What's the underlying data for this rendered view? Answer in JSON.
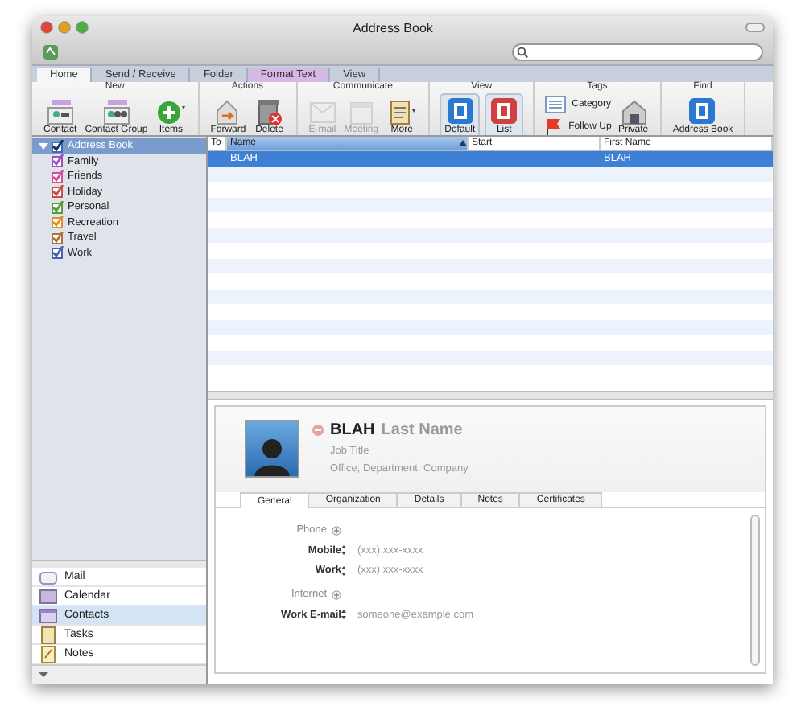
{
  "window": {
    "title": "Address Book"
  },
  "ribbon": {
    "tabs": [
      {
        "label": "Home",
        "selected": true,
        "contextual": false
      },
      {
        "label": "Send / Receive",
        "selected": false,
        "contextual": false
      },
      {
        "label": "Folder",
        "selected": false,
        "contextual": false
      },
      {
        "label": "Format Text",
        "selected": false,
        "contextual": true
      },
      {
        "label": "View",
        "selected": false,
        "contextual": false
      }
    ],
    "groups": [
      {
        "title": "New",
        "buttons": [
          {
            "label": "Contact",
            "kind": "large",
            "disabled": false
          },
          {
            "label": "Contact Group",
            "kind": "large",
            "disabled": false
          },
          {
            "label": "Items",
            "kind": "large",
            "disabled": false
          }
        ]
      },
      {
        "title": "Actions",
        "buttons": [
          {
            "label": "Forward",
            "kind": "large",
            "disabled": false
          },
          {
            "label": "Delete",
            "kind": "large",
            "disabled": false
          }
        ]
      },
      {
        "title": "Communicate",
        "buttons": [
          {
            "label": "E-mail",
            "kind": "large",
            "disabled": true
          },
          {
            "label": "Meeting",
            "kind": "large",
            "disabled": true
          },
          {
            "label": "More",
            "kind": "large",
            "disabled": false
          }
        ]
      },
      {
        "title": "View",
        "buttons": [
          {
            "label": "Default",
            "kind": "large",
            "disabled": false
          },
          {
            "label": "List",
            "kind": "large",
            "disabled": false
          }
        ]
      },
      {
        "title": "Tags",
        "buttons": [
          {
            "label": "Category",
            "kind": "small",
            "disabled": false
          },
          {
            "label": "Follow Up",
            "kind": "small",
            "disabled": false
          },
          {
            "label": "Private",
            "kind": "large",
            "disabled": false
          }
        ]
      },
      {
        "title": "Find",
        "buttons": [
          {
            "label": "Address Book",
            "kind": "large",
            "disabled": false
          }
        ]
      }
    ]
  },
  "tree": {
    "items": [
      {
        "label": "Address Book",
        "checked": true,
        "expanded": true,
        "selected": true,
        "children": [
          {
            "label": "Family",
            "checked": true,
            "color": "#9b4fc0"
          },
          {
            "label": "Friends",
            "checked": true,
            "color": "#d0509a"
          },
          {
            "label": "Holiday",
            "checked": true,
            "color": "#c8504a"
          },
          {
            "label": "Personal",
            "checked": true,
            "color": "#5a9a3a"
          },
          {
            "label": "Recreation",
            "checked": true,
            "color": "#e0902a"
          },
          {
            "label": "Travel",
            "checked": true,
            "color": "#b07040"
          },
          {
            "label": "Work",
            "checked": true,
            "color": "#5060b0"
          }
        ]
      }
    ]
  },
  "navigation": [
    {
      "label": "Mail",
      "selected": false
    },
    {
      "label": "Calendar",
      "selected": false
    },
    {
      "label": "Contacts",
      "selected": true
    },
    {
      "label": "Tasks",
      "selected": false
    },
    {
      "label": "Notes",
      "selected": false
    }
  ],
  "table": {
    "columns": [
      {
        "label": "To",
        "sorted": false
      },
      {
        "label": "Name",
        "sorted": true
      },
      {
        "label": "Start",
        "sorted": false
      },
      {
        "label": "First Name",
        "sorted": false
      }
    ],
    "rows": [
      {
        "cells": [
          "",
          "BLAH",
          "",
          "BLAH"
        ],
        "selected": true
      }
    ]
  },
  "contact": {
    "first_name": "BLAH",
    "last_name": "Last Name",
    "job_title": "Job Title",
    "company_line": "Office, Department, Company",
    "tabs": [
      {
        "label": "General",
        "selected": true
      },
      {
        "label": "Organization",
        "selected": false
      },
      {
        "label": "Details",
        "selected": false
      },
      {
        "label": "Notes",
        "selected": false
      },
      {
        "label": "Certificates",
        "selected": false
      }
    ],
    "fields": [
      {
        "kind": "section",
        "label": "Phone"
      },
      {
        "kind": "field",
        "label": "Mobile",
        "placeholder": "(xxx) xxx-xxxx"
      },
      {
        "kind": "field",
        "label": "Work",
        "placeholder": "(xxx) xxx-xxxx"
      },
      {
        "kind": "section",
        "label": "Internet"
      },
      {
        "kind": "field",
        "label": "Work E-mail",
        "placeholder": "someone@example.com"
      }
    ]
  }
}
